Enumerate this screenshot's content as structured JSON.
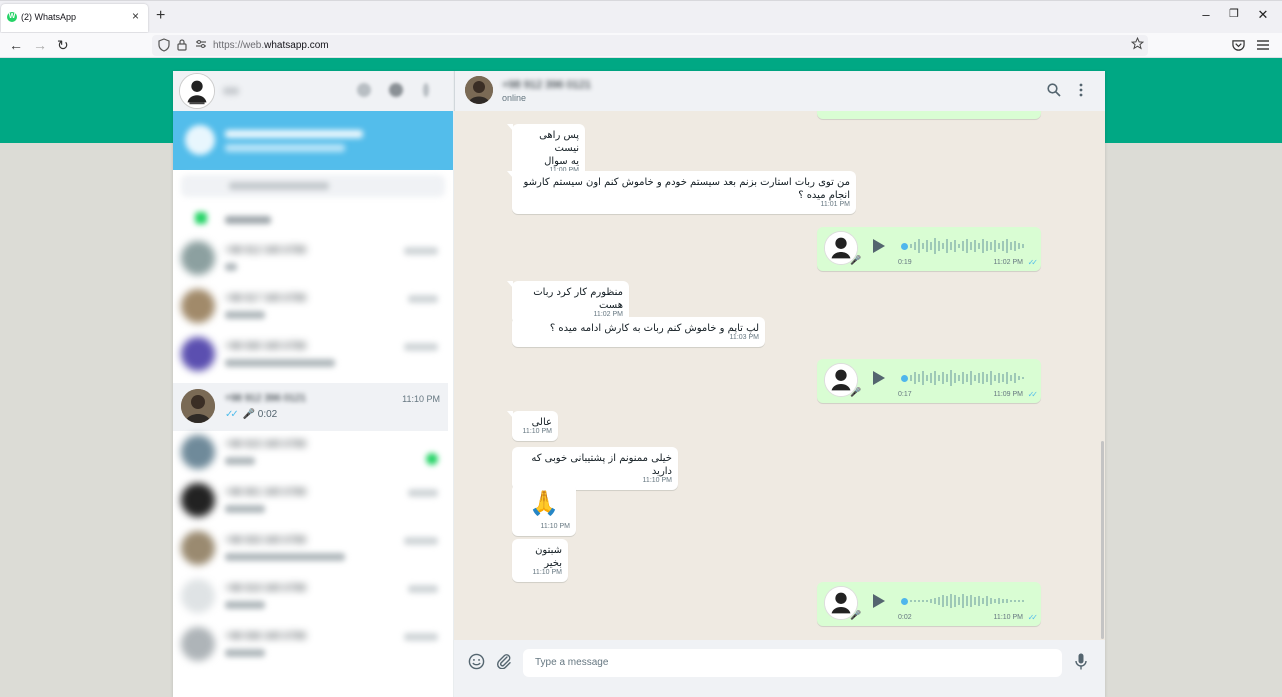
{
  "browser": {
    "tab_title": "(2) WhatsApp",
    "tab_close": "×",
    "new_tab": "+",
    "url_prefix": "https://web.",
    "url_domain": "whatsapp.com",
    "win_minimize": "–",
    "win_maximize": "❐",
    "win_close": "✕",
    "back": "←",
    "forward": "→",
    "reload": "↻",
    "favicon_letter": "W"
  },
  "colors": {
    "brand_green": "#00a884",
    "outgoing_bubble": "#d9fdd3",
    "read_ticks": "#53bdeb",
    "sidebar_banner": "#53bdeb"
  },
  "sidebar": {
    "chats": [
      {
        "name": "+98 912 345 6789",
        "time": "",
        "preview": "",
        "active": false
      },
      {
        "name": "+98 917 345 6789",
        "time": "",
        "preview": "",
        "active": false
      },
      {
        "name": "+98 930 345 6789",
        "time": "",
        "preview": "",
        "active": false
      },
      {
        "name": "+98 912 396 0121",
        "time": "11:10 PM",
        "preview": "0:02",
        "active": true
      },
      {
        "name": "+98 915 345 6789",
        "time": "",
        "preview": "",
        "active": false
      },
      {
        "name": "+98 901 345 6789",
        "time": "",
        "preview": "",
        "active": false
      },
      {
        "name": "+98 933 345 6789",
        "time": "",
        "preview": "",
        "active": false
      },
      {
        "name": "+98 919 345 6789",
        "time": "",
        "preview": "",
        "active": false
      },
      {
        "name": "+98 936 345 6789",
        "time": "",
        "preview": "",
        "active": false
      }
    ]
  },
  "conversation": {
    "contact_status": "online",
    "search_icon": "⚲",
    "menu_icon": "⋮",
    "messages": [
      {
        "type": "text",
        "direction": "in",
        "text": "پس راهی نیست\nیه سوال",
        "time": "11:00 PM"
      },
      {
        "type": "text",
        "direction": "in",
        "text": "من توی ربات استارت بزنم بعد سیستم خودم و خاموش کنم اون سیستم کارشو انجام میده ؟",
        "time": "11:01 PM"
      },
      {
        "type": "voice",
        "direction": "out",
        "duration": "0:19",
        "time": "11:02 PM"
      },
      {
        "type": "text",
        "direction": "in",
        "text": "منظورم کار کرد ربات هست",
        "time": "11:02 PM"
      },
      {
        "type": "text",
        "direction": "in",
        "text": "لپ تاپم و خاموش کنم ربات به کارش ادامه میده ؟",
        "time": "11:03 PM"
      },
      {
        "type": "voice",
        "direction": "out",
        "duration": "0:17",
        "time": "11:09 PM"
      },
      {
        "type": "text",
        "direction": "in",
        "text": "عالی",
        "time": "11:10 PM"
      },
      {
        "type": "text",
        "direction": "in",
        "text": "خیلی ممنونم از پشتیبانی خوبی که دارید",
        "time": "11:10 PM"
      },
      {
        "type": "emoji",
        "direction": "in",
        "text": "🙏",
        "time": "11:10 PM"
      },
      {
        "type": "text",
        "direction": "in",
        "text": "شبتون بخیر",
        "time": "11:10 PM"
      },
      {
        "type": "voice",
        "direction": "out",
        "duration": "0:02",
        "time": "11:10 PM"
      }
    ]
  },
  "composer": {
    "placeholder": "Type a message",
    "emoji_icon": "☺",
    "attach_icon": "📎",
    "mic_icon": "🎙"
  }
}
